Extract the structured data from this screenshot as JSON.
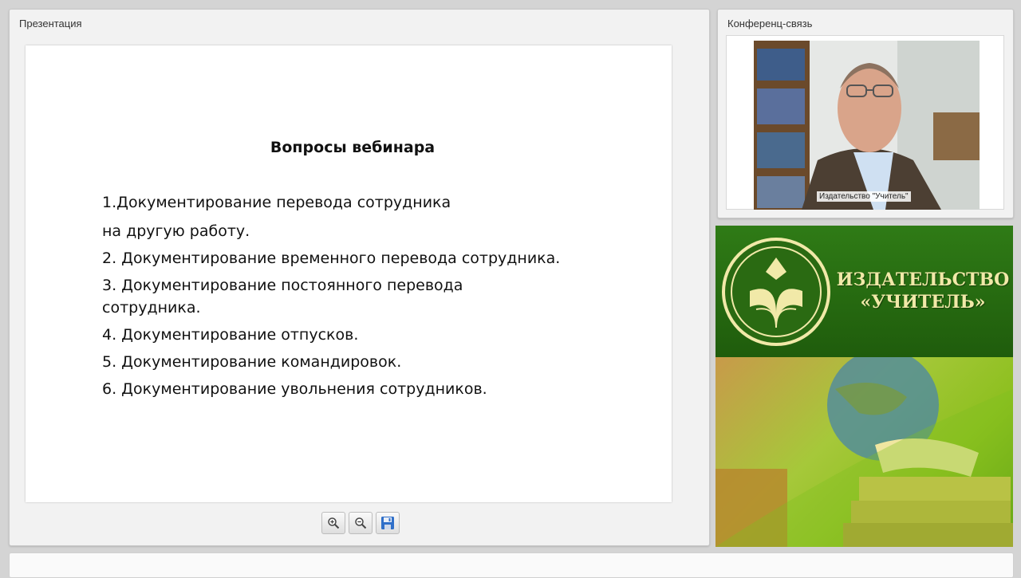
{
  "presentation": {
    "title": "Презентация",
    "slide": {
      "heading": "Вопросы вебинара",
      "lines": [
        "1.Документирование перевода сотрудника",
        "на другую работу.",
        "2. Документирование временного перевода сотрудника.",
        "3. Документирование постоянного перевода",
        "сотрудника.",
        "4. Документирование отпусков.",
        "5. Документирование командировок.",
        "6. Документирование увольнения сотрудников."
      ]
    },
    "toolbar": {
      "zoom_in_icon": "zoom-in-icon",
      "zoom_out_icon": "zoom-out-icon",
      "save_icon": "floppy-disk-icon"
    }
  },
  "conference": {
    "title": "Конференц-связь",
    "video_label": "Издательство \"Учитель\""
  },
  "brand": {
    "line1": "ИЗДАТЕЛЬСТВО",
    "line2": "«УЧИТЕЛЬ»",
    "colors": {
      "green": "#2f7b16",
      "gold": "#f1e9a8"
    }
  }
}
